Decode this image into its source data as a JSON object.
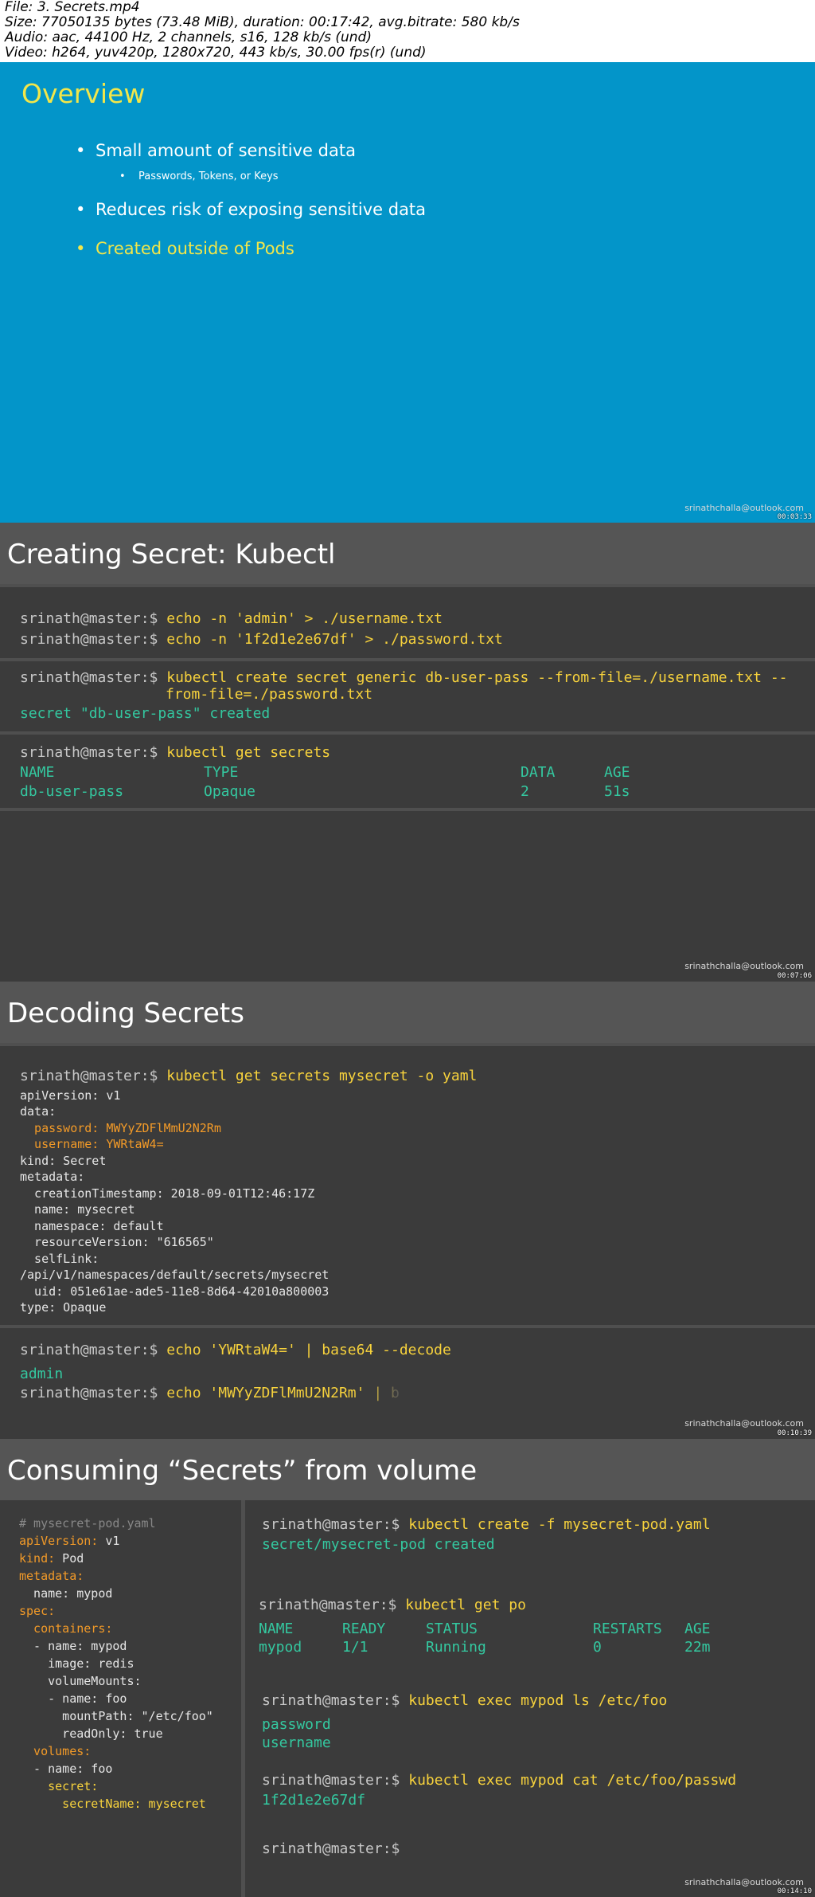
{
  "file_info": [
    "File: 3. Secrets.mp4",
    "Size: 77050135 bytes (73.48 MiB), duration: 00:17:42, avg.bitrate: 580 kb/s",
    "Audio: aac, 44100 Hz, 2 channels, s16, 128 kb/s (und)",
    "Video: h264, yuv420p, 1280x720, 443 kb/s, 30.00 fps(r) (und)"
  ],
  "watermark": "srinathchalla@outlook.com",
  "timestamps": [
    "00:03:33",
    "00:07:06",
    "00:10:39",
    "00:14:10"
  ],
  "overview": {
    "title": "Overview",
    "bullets": [
      "Small amount of sensitive data",
      "Reduces risk of exposing sensitive data",
      "Created outside of Pods"
    ],
    "sub_bullet": "Passwords, Tokens, or Keys",
    "bullet_glyph": "•"
  },
  "creating": {
    "title": "Creating Secret:  Kubectl",
    "prompt": "srinath@master:$",
    "cmd1": "echo -n 'admin' > ./username.txt",
    "cmd2": "echo -n '1f2d1e2e67df' > ./password.txt",
    "cmd3a": "kubectl create secret generic db-user-pass --from-file=./username.txt --",
    "cmd3b": "from-file=./password.txt",
    "out3": "secret \"db-user-pass\" created",
    "cmd4": "kubectl get secrets",
    "table_header": [
      "NAME",
      "TYPE",
      "DATA",
      "AGE"
    ],
    "table_row": [
      "db-user-pass",
      "Opaque",
      "2",
      "51s"
    ]
  },
  "decoding": {
    "title": "Decoding Secrets",
    "prompt": "srinath@master:$",
    "cmd1": "kubectl get secrets mysecret -o yaml",
    "yaml": [
      "apiVersion: v1",
      "data:",
      "  password: MWYyZDFlMmU2N2Rm",
      "  username: YWRtaW4=",
      "kind: Secret",
      "metadata:",
      "  creationTimestamp: 2018-09-01T12:46:17Z",
      "  name: mysecret",
      "  namespace: default",
      "  resourceVersion: \"616565\"",
      "  selfLink:",
      "/api/v1/namespaces/default/secrets/mysecret",
      "  uid: 051e61ae-ade5-11e8-8d64-42010a800003",
      "type: Opaque"
    ],
    "cmd2": "echo 'YWRtaW4=' | base64 --decode",
    "out2": "admin",
    "cmd3": "echo 'MWYyZDFlMmU2N2Rm' | b"
  },
  "consuming": {
    "title": "Consuming “Secrets” from volume",
    "yaml_lines": [
      {
        "k": "# mysecret-pod.yaml",
        "v": ""
      },
      {
        "k": "apiVersion:",
        "v": " v1"
      },
      {
        "k": "kind:",
        "v": " Pod"
      },
      {
        "k": "metadata:",
        "v": ""
      },
      {
        "k": "  name:",
        "v": " mypod"
      },
      {
        "k": "spec:",
        "v": ""
      },
      {
        "k": "  containers:",
        "v": ""
      },
      {
        "k": "  - name:",
        "v": " mypod"
      },
      {
        "k": "    image:",
        "v": " redis"
      },
      {
        "k": "    volumeMounts:",
        "v": ""
      },
      {
        "k": "    - name:",
        "v": " foo"
      },
      {
        "k": "      mountPath:",
        "v": " \"/etc/foo\""
      },
      {
        "k": "      readOnly:",
        "v": " true"
      },
      {
        "k": "  volumes:",
        "v": ""
      },
      {
        "k": "  - name:",
        "v": " foo"
      },
      {
        "k": "    secret:",
        "v": ""
      },
      {
        "k": "      secretName:",
        "v": " mysecret"
      }
    ],
    "prompt": "srinath@master:$",
    "cmd1": "kubectl create -f mysecret-pod.yaml",
    "out1": "secret/mysecret-pod created",
    "cmd2": "kubectl get po",
    "table_header": [
      "NAME",
      "READY",
      "STATUS",
      "RESTARTS",
      "AGE"
    ],
    "table_row": [
      "mypod",
      "1/1",
      "Running",
      "0",
      "22m"
    ],
    "cmd3": "kubectl exec mypod ls /etc/foo",
    "out3a": "password",
    "out3b": "username",
    "cmd4": "kubectl exec mypod cat /etc/foo/passwd",
    "out4": "1f2d1e2e67df"
  }
}
